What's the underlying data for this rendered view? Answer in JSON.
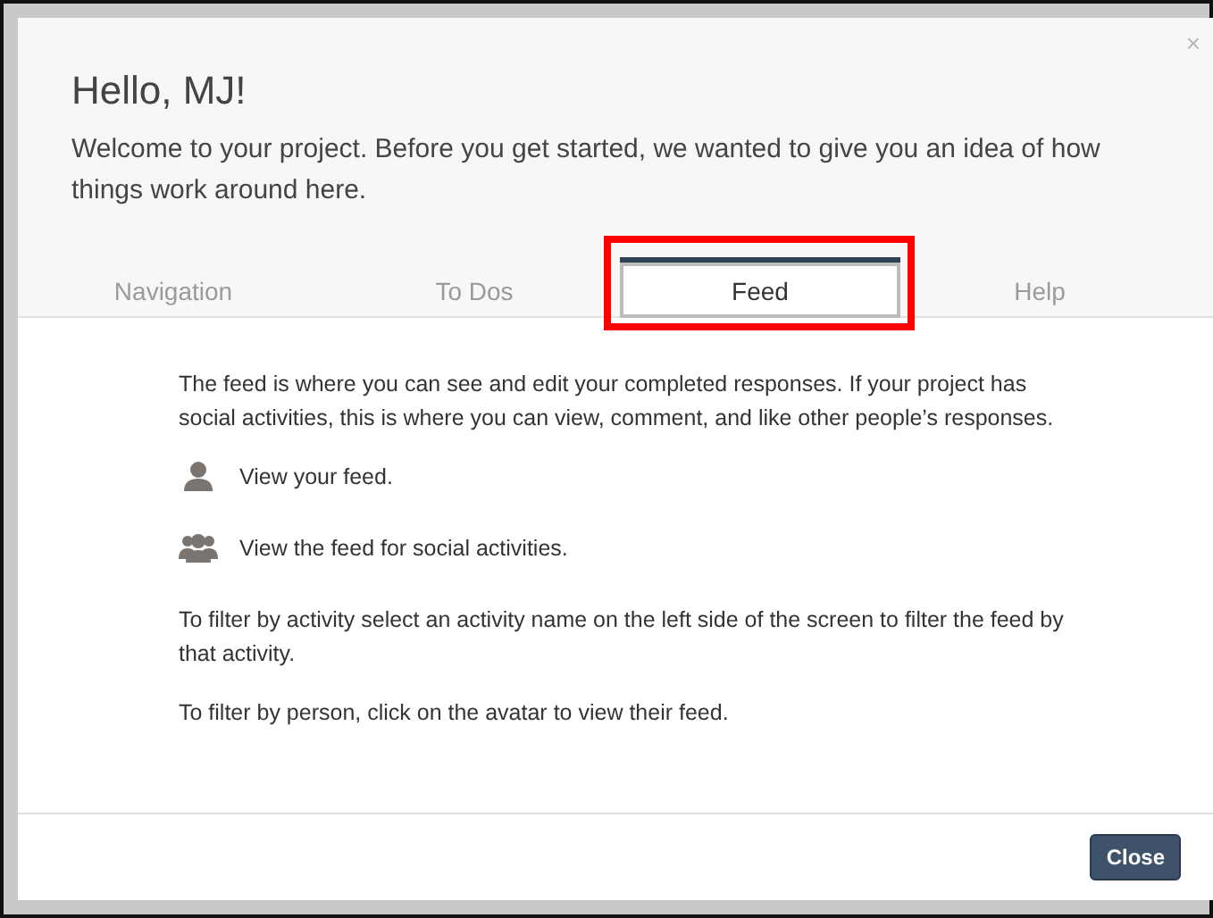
{
  "dialog": {
    "close_glyph": "×",
    "title": "Hello, MJ!",
    "intro": "Welcome to your project. Before you get started, we wanted to give you an idea of how things work around here."
  },
  "tabs": [
    {
      "label": "Navigation",
      "selected": false,
      "highlighted": false
    },
    {
      "label": "To Dos",
      "selected": false,
      "highlighted": false
    },
    {
      "label": "Feed",
      "selected": true,
      "highlighted": true
    },
    {
      "label": "Help",
      "selected": false,
      "highlighted": false
    }
  ],
  "content": [
    {
      "kind": "paragraph",
      "text": "The feed is where you can see and edit your completed responses. If your project has social activities, this is where you can view, comment, and like other people’s responses."
    },
    {
      "kind": "person",
      "text": "View your feed."
    },
    {
      "kind": "group",
      "text": "View the feed for social activities."
    },
    {
      "kind": "paragraph",
      "text": "To filter by activity select an activity name on the left side of the screen to filter the feed by that activity."
    },
    {
      "kind": "paragraph",
      "text": "To filter by person, click on the avatar to view their feed."
    }
  ],
  "footer": {
    "button": "Close"
  }
}
